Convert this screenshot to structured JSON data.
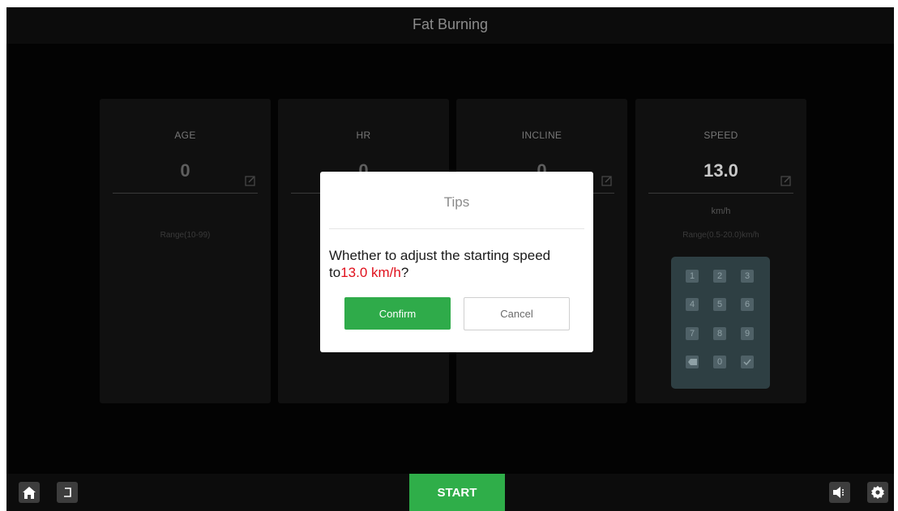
{
  "header": {
    "title": "Fat Burning"
  },
  "cards": [
    {
      "label": "AGE",
      "value": "0",
      "unit": "",
      "range": "Range(10-99)"
    },
    {
      "label": "HR",
      "value": "0",
      "unit": "",
      "range": ""
    },
    {
      "label": "INCLINE",
      "value": "0",
      "unit": "",
      "range": ""
    },
    {
      "label": "SPEED",
      "value": "13.0",
      "unit": "km/h",
      "range": "Range(0.5-20.0)km/h"
    }
  ],
  "keypad": {
    "keys": [
      "1",
      "2",
      "3",
      "4",
      "5",
      "6",
      "7",
      "8",
      "9",
      "backspace",
      "0",
      "confirm"
    ],
    "labels": {
      "k1": "1",
      "k2": "2",
      "k3": "3",
      "k4": "4",
      "k5": "5",
      "k6": "6",
      "k7": "7",
      "k8": "8",
      "k9": "9",
      "k0": "0"
    }
  },
  "dialog": {
    "title": "Tips",
    "message_prefix": "Whether to adjust the starting speed to",
    "message_value": "13.0 km/h",
    "message_suffix": "?",
    "confirm_label": "Confirm",
    "cancel_label": "Cancel"
  },
  "footer": {
    "start_label": "START",
    "icons": [
      "home-icon",
      "back-icon",
      "volume-icon",
      "settings-icon"
    ]
  },
  "colors": {
    "accent_green": "#2fab4a",
    "highlight_red": "#e0101c",
    "keypad_bg": "#2e3f43"
  }
}
